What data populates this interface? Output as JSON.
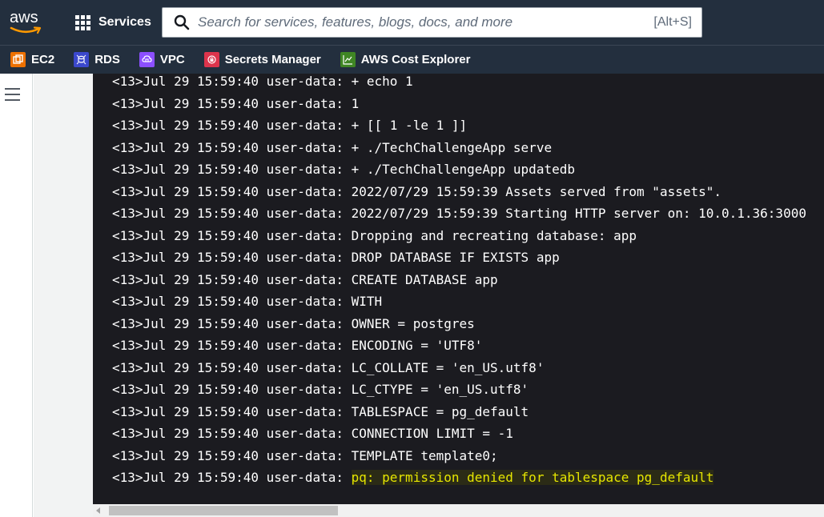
{
  "header": {
    "logo_text": "aws",
    "services_label": "Services",
    "search_placeholder": "Search for services, features, blogs, docs, and more",
    "search_shortcut": "[Alt+S]"
  },
  "favorites": [
    {
      "label": "EC2",
      "icon": "ec2-icon",
      "color": "#ed7100"
    },
    {
      "label": "RDS",
      "icon": "rds-icon",
      "color": "#3b48cc"
    },
    {
      "label": "VPC",
      "icon": "vpc-icon",
      "color": "#8c4fff"
    },
    {
      "label": "Secrets Manager",
      "icon": "secrets-manager-icon",
      "color": "#dd344c"
    },
    {
      "label": "AWS Cost Explorer",
      "icon": "cost-explorer-icon",
      "color": "#3f8624"
    }
  ],
  "console": {
    "lines": [
      {
        "prefix": "<13>Jul 29 15:59:40 user-data: ",
        "message": "+ echo 1"
      },
      {
        "prefix": "<13>Jul 29 15:59:40 user-data: ",
        "message": "1"
      },
      {
        "prefix": "<13>Jul 29 15:59:40 user-data: ",
        "message": "+ [[ 1 -le 1 ]]"
      },
      {
        "prefix": "<13>Jul 29 15:59:40 user-data: ",
        "message": "+ ./TechChallengeApp serve"
      },
      {
        "prefix": "<13>Jul 29 15:59:40 user-data: ",
        "message": "+ ./TechChallengeApp updatedb"
      },
      {
        "prefix": "<13>Jul 29 15:59:40 user-data: ",
        "message": "2022/07/29 15:59:39 Assets served from \"assets\"."
      },
      {
        "prefix": "<13>Jul 29 15:59:40 user-data: ",
        "message": "2022/07/29 15:59:39 Starting HTTP server on: 10.0.1.36:3000"
      },
      {
        "prefix": "<13>Jul 29 15:59:40 user-data: ",
        "message": "Dropping and recreating database: app"
      },
      {
        "prefix": "<13>Jul 29 15:59:40 user-data: ",
        "message": "DROP DATABASE IF EXISTS app"
      },
      {
        "prefix": "<13>Jul 29 15:59:40 user-data: ",
        "message": "CREATE DATABASE app"
      },
      {
        "prefix": "<13>Jul 29 15:59:40 user-data: ",
        "message": "WITH"
      },
      {
        "prefix": "<13>Jul 29 15:59:40 user-data: ",
        "message": "OWNER = postgres"
      },
      {
        "prefix": "<13>Jul 29 15:59:40 user-data: ",
        "message": "ENCODING = 'UTF8'"
      },
      {
        "prefix": "<13>Jul 29 15:59:40 user-data: ",
        "message": "LC_COLLATE = 'en_US.utf8'"
      },
      {
        "prefix": "<13>Jul 29 15:59:40 user-data: ",
        "message": "LC_CTYPE = 'en_US.utf8'"
      },
      {
        "prefix": "<13>Jul 29 15:59:40 user-data: ",
        "message": "TABLESPACE = pg_default"
      },
      {
        "prefix": "<13>Jul 29 15:59:40 user-data: ",
        "message": "CONNECTION LIMIT = -1"
      },
      {
        "prefix": "<13>Jul 29 15:59:40 user-data: ",
        "message": "TEMPLATE template0;"
      },
      {
        "prefix": "<13>Jul 29 15:59:40 user-data: ",
        "message": "pq: permission denied for tablespace pg_default",
        "highlighted": true
      }
    ],
    "highlight_color": "#e6e600"
  }
}
